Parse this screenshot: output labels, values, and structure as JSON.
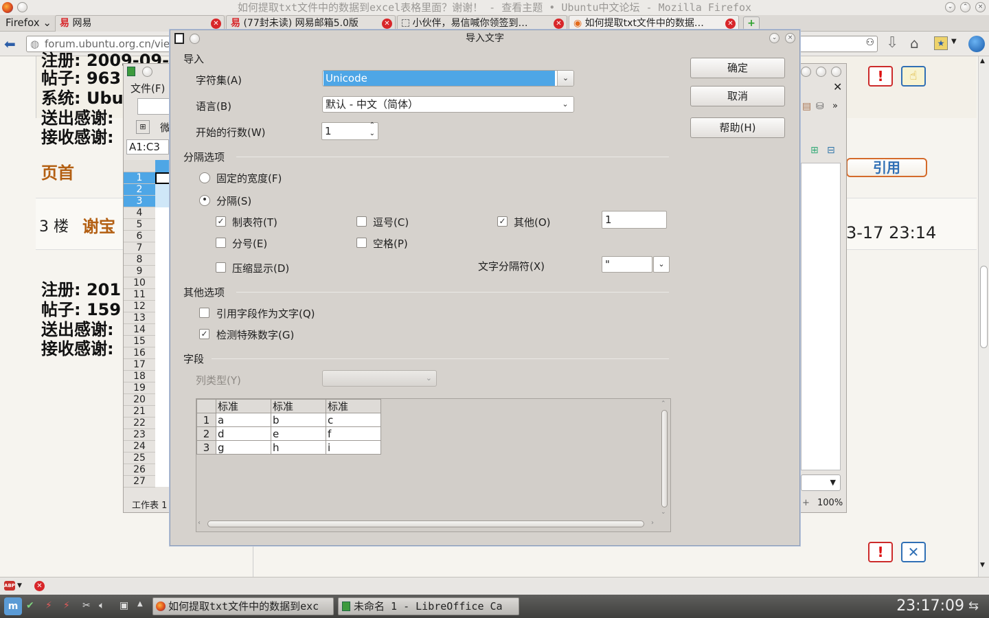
{
  "firefox": {
    "title": "如何提取txt文件中的数据到excel表格里面？谢谢！ - 查看主题 • Ubuntu中文论坛 - Mozilla Firefox",
    "menu": "Firefox",
    "tabs": [
      {
        "label": "网易"
      },
      {
        "label": "(77封未读) 网易邮箱5.0版"
      },
      {
        "label": "小伙伴，易信喊你领签到…"
      },
      {
        "label": "如何提取txt文件中的数据…"
      }
    ],
    "url": "forum.ubuntu.org.cn/view"
  },
  "forum": {
    "line1": "帖子: 963",
    "line2": "系统: Ubu",
    "line3": "送出感谢:",
    "line4": "接收感谢:",
    "top_link": "页首",
    "floor": "3 楼",
    "author": "谢宝",
    "time": "3-17 23:14",
    "reply": "引用",
    "line5": "注册: 201",
    "line6": "帖子: 159",
    "line7": "送出感谢:",
    "line8": "接收感谢:",
    "line0": "注册: 2009-09-2"
  },
  "calc": {
    "menu_file": "文件(F)",
    "cell_ref": "A1:C3",
    "btn_label": "微",
    "rows": [
      "1",
      "2",
      "3",
      "4",
      "5",
      "6",
      "7",
      "8",
      "9",
      "10",
      "11",
      "12",
      "13",
      "14",
      "15",
      "16",
      "17",
      "18",
      "19",
      "20",
      "21",
      "22",
      "23",
      "24",
      "25",
      "26",
      "27"
    ],
    "sheet_tab": "工作表 1 /",
    "zoom": "100%"
  },
  "dialog": {
    "title": "导入文字",
    "import_section": "导入",
    "charset_label": "字符集(A)",
    "charset_value": "Unicode",
    "language_label": "语言(B)",
    "language_value": "默认 - 中文（简体）",
    "start_row_label": "开始的行数(W)",
    "start_row_value": "1",
    "sep_section": "分隔选项",
    "fixed_width": "固定的宽度(F)",
    "separated": "分隔(S)",
    "tab": "制表符(T)",
    "comma": "逗号(C)",
    "other": "其他(O)",
    "other_value": "1",
    "semicolon": "分号(E)",
    "space": "空格(P)",
    "merge": "压缩显示(D)",
    "text_delim_label": "文字分隔符(X)",
    "text_delim_value": "\"",
    "other_section": "其他选项",
    "quoted_as_text": "引用字段作为文字(Q)",
    "detect_special": "检测特殊数字(G)",
    "fields_section": "字段",
    "column_type_label": "列类型(Y)",
    "ok": "确定",
    "cancel": "取消",
    "help": "帮助(H)",
    "preview_headers": [
      "标准",
      "标准",
      "标准"
    ],
    "preview_rows": [
      {
        "n": "1",
        "a": "a",
        "b": "b",
        "c": "c"
      },
      {
        "n": "2",
        "a": "d",
        "b": "e",
        "c": "f"
      },
      {
        "n": "3",
        "a": "g",
        "b": "h",
        "c": "i"
      }
    ]
  },
  "taskbar": {
    "task1": "如何提取txt文件中的数据到exc",
    "task2": "未命名 1 - LibreOffice Ca",
    "clock": "23:17:09"
  },
  "colors": {
    "selection": "#4ea6e6",
    "accent_red": "#d8262a",
    "title_text": "#9a9895"
  }
}
